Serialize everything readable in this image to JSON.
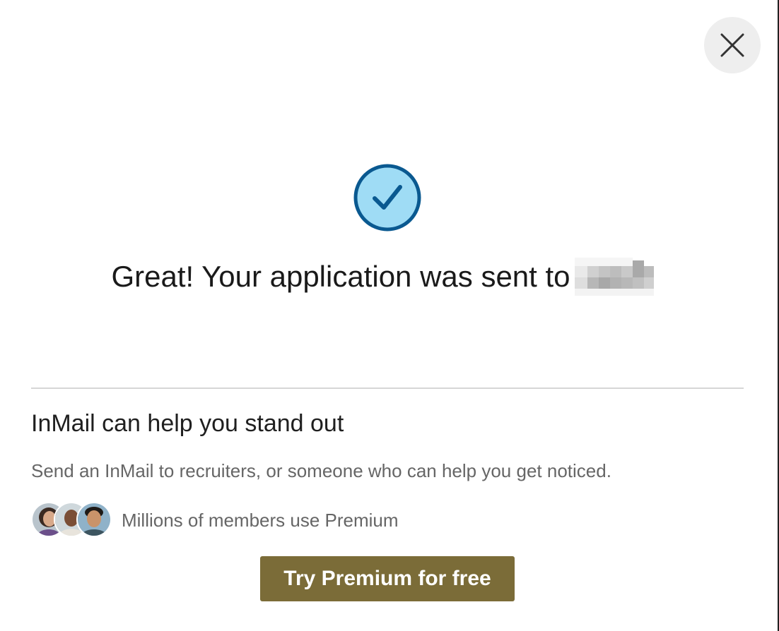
{
  "dialog": {
    "close_icon": "close-icon",
    "success_icon": "checkmark-circle-icon",
    "headline": "Great! Your application was sent to",
    "recipient_redacted": true
  },
  "promo": {
    "title": "InMail can help you stand out",
    "description": "Send an InMail to recruiters, or someone who can help you get noticed.",
    "members_text": "Millions of members use Premium",
    "avatar_count": 3,
    "cta_label": "Try Premium for free"
  },
  "colors": {
    "check_fill": "#9fdcf5",
    "check_stroke": "#0a5990",
    "cta_background": "#7b6c38",
    "cta_text": "#ffffff",
    "close_background": "#eeeeee"
  }
}
